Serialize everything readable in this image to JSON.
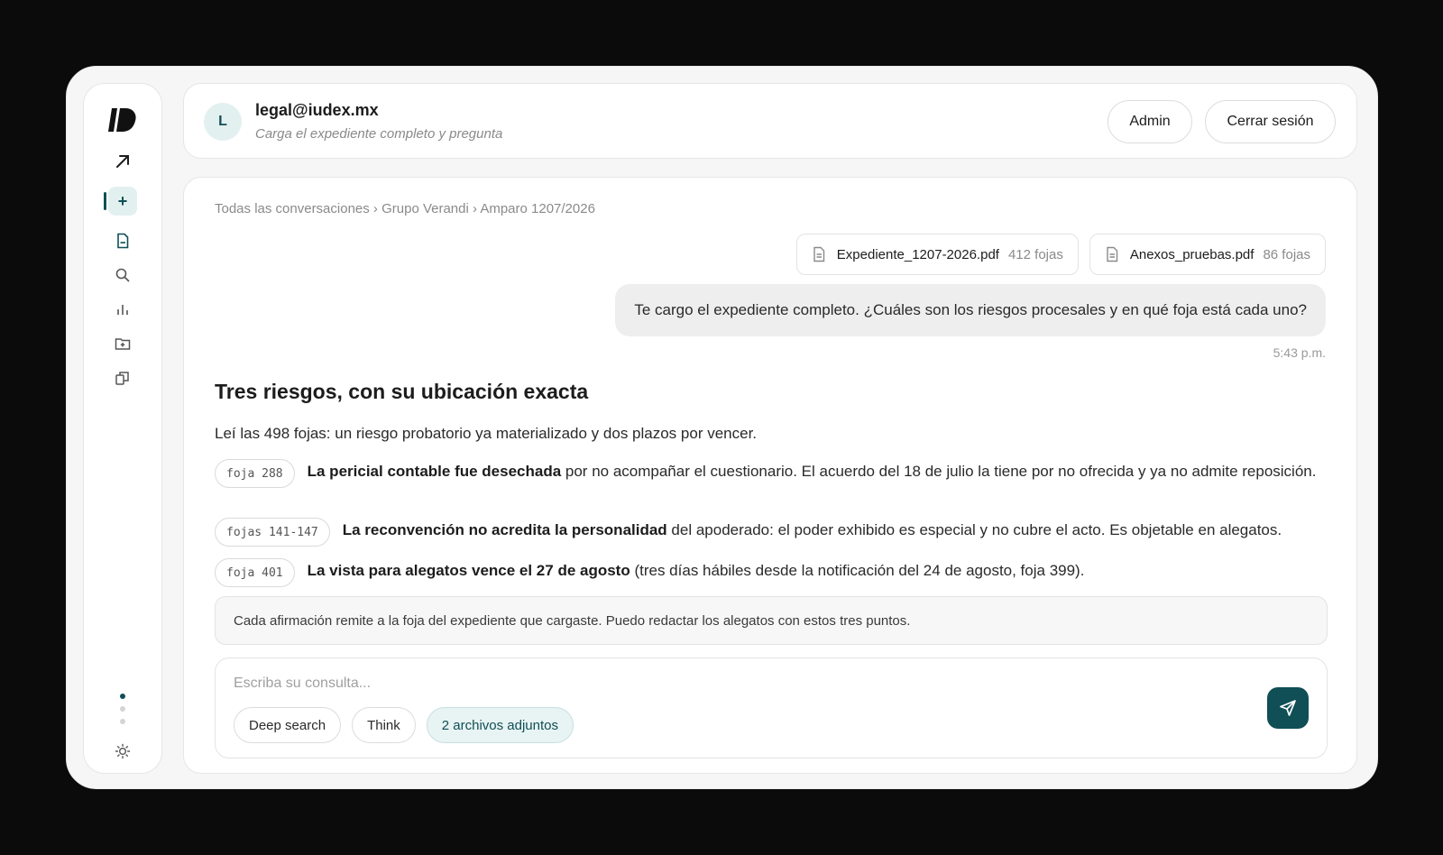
{
  "colors": {
    "accent": "#0f4f55",
    "accent_soft": "#e3f0f0",
    "backdrop": "#0b0b0b"
  },
  "sidebar": {
    "items": [
      {
        "icon": "logo-icon"
      },
      {
        "icon": "arrow-up-right-icon"
      },
      {
        "icon": "plus-icon",
        "label": "+"
      },
      {
        "icon": "document-icon"
      },
      {
        "icon": "search-icon"
      },
      {
        "icon": "bar-chart-icon"
      },
      {
        "icon": "folder-add-icon"
      },
      {
        "icon": "copy-icon"
      },
      {
        "icon": "sun-icon"
      }
    ]
  },
  "header": {
    "avatar_initial": "L",
    "email": "legal@iudex.mx",
    "subtitle": "Carga el expediente completo y pregunta",
    "admin_label": "Admin",
    "logout_label": "Cerrar sesión"
  },
  "breadcrumb": "Todas las conversaciones › Grupo Verandi › Amparo 1207/2026",
  "files": [
    {
      "name": "Expediente_1207-2026.pdf",
      "pages": "412 fojas"
    },
    {
      "name": "Anexos_pruebas.pdf",
      "pages": "86 fojas"
    }
  ],
  "user_message": {
    "text": "Te cargo el expediente completo. ¿Cuáles son los riesgos procesales y en qué foja está cada uno?",
    "time": "5:43 p.m."
  },
  "answer": {
    "title": "Tres riesgos, con su ubicación exacta",
    "intro": "Leí las 498 fojas: un riesgo probatorio ya materializado y dos plazos por vencer.",
    "risks": [
      {
        "tag": "foja 288",
        "bold": "La pericial contable fue desechada",
        "rest": " por no acompañar el cuestionario. El acuerdo del 18 de julio la tiene por no ofrecida y ya no admite reposición."
      },
      {
        "tag": "fojas 141-147",
        "bold": "La reconvención no acredita la personalidad",
        "rest": " del apoderado: el poder exhibido es especial y no cubre el acto. Es objetable en alegatos."
      },
      {
        "tag": "foja 401",
        "bold": "La vista para alegatos vence el 27 de agosto",
        "rest": " (tres días hábiles desde la notificación del 24 de agosto, foja 399)."
      }
    ],
    "note": "Cada afirmación remite a la foja del expediente que cargaste. Puedo redactar los alegatos con estos tres puntos."
  },
  "composer": {
    "placeholder": "Escriba su consulta...",
    "chips": [
      "Deep search",
      "Think",
      "2 archivos adjuntos"
    ]
  }
}
